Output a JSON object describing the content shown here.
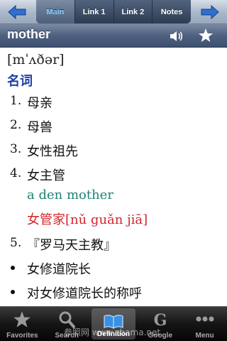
{
  "nav": {
    "tabs": [
      {
        "label": "Main",
        "active": true
      },
      {
        "label": "Link 1",
        "active": false
      },
      {
        "label": "Link 2",
        "active": false
      },
      {
        "label": "Notes",
        "active": false
      }
    ],
    "back_icon": "arrow-left-icon",
    "forward_icon": "arrow-right-icon"
  },
  "entry": {
    "word": "mother",
    "speaker_icon": "speaker-icon",
    "favorite_icon": "star-icon",
    "phonetic": "[mˈʌðər]",
    "part_of_speech": "名词",
    "definitions": [
      {
        "marker": "1.",
        "text": "母亲"
      },
      {
        "marker": "2.",
        "text": "母兽"
      },
      {
        "marker": "3.",
        "text": "女性祖先"
      },
      {
        "marker": "4.",
        "text": "女主管"
      }
    ],
    "example_en": "a den mother",
    "example_zh": "女管家[nǔ guǎn jiā]",
    "definition_5": {
      "marker": "5.",
      "text": "『罗马天主教』"
    },
    "bullets": [
      "女修道院长",
      "对女修道院长的称呼"
    ]
  },
  "toolbar": {
    "items": [
      {
        "label": "Favorites",
        "icon": "star-icon",
        "active": false
      },
      {
        "label": "Search",
        "icon": "magnifier-icon",
        "active": false
      },
      {
        "label": "Definition",
        "icon": "book-icon",
        "active": true
      },
      {
        "label": "Google",
        "icon": "google-g-icon",
        "active": false
      },
      {
        "label": "Menu",
        "icon": "more-dots-icon",
        "active": false
      }
    ]
  },
  "watermark": "参照网 www.cbama.net",
  "colors": {
    "accent_blue": "#1f3fa8",
    "example_green": "#1e8278",
    "example_red": "#d3242a",
    "active_tab_text": "#8fd2ff"
  }
}
